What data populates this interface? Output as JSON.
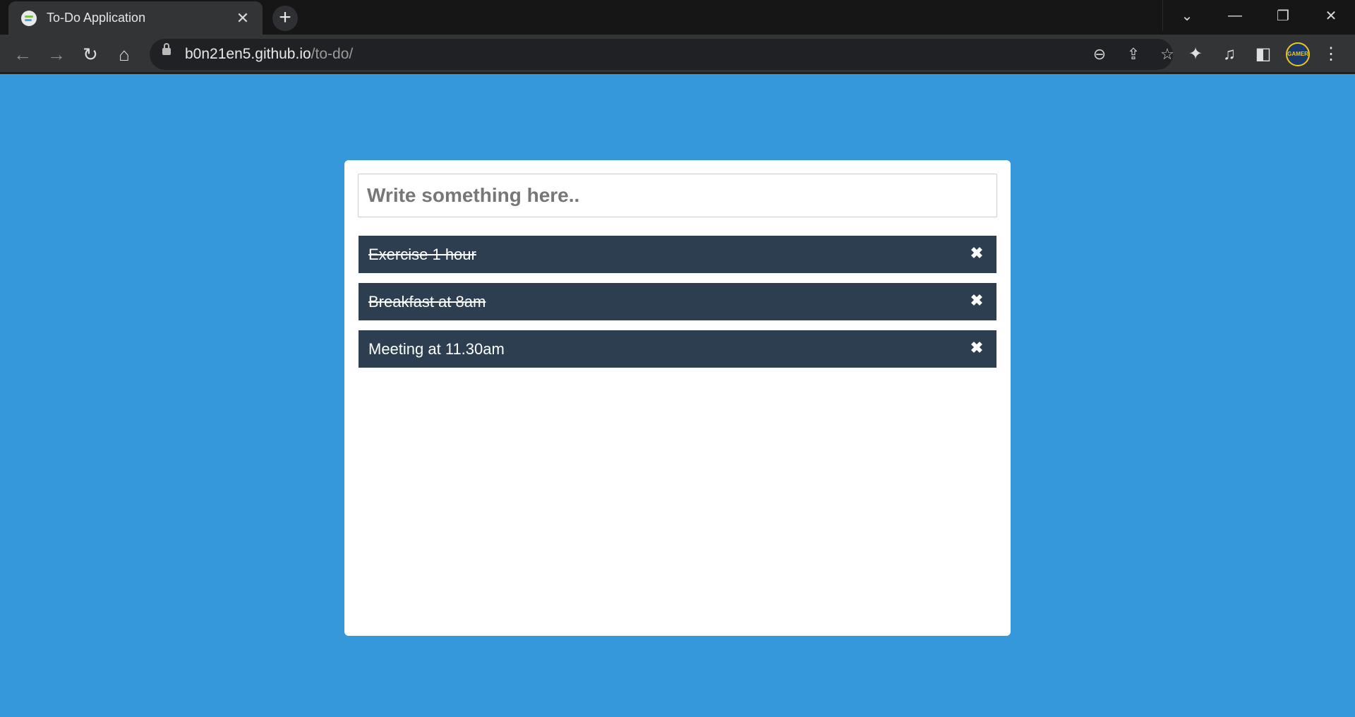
{
  "browser": {
    "tab": {
      "title": "To-Do Application",
      "favicon": "todo-favicon",
      "close_glyph": "✕"
    },
    "new_tab_glyph": "+",
    "window_controls": {
      "tab_search_glyph": "⌄",
      "minimize_glyph": "—",
      "restore_glyph": "❐",
      "close_glyph": "✕"
    },
    "nav": {
      "back_glyph": "←",
      "forward_glyph": "→",
      "reload_glyph": "↻",
      "home_glyph": "⌂"
    },
    "address": {
      "host": "b0n21en5.github.io",
      "path": "/to-do/"
    },
    "omnibox_icons": {
      "zoom_glyph": "⊖",
      "share_glyph": "⇪",
      "bookmark_glyph": "☆"
    },
    "toolbar_icons": {
      "extensions_glyph": "✦",
      "media_glyph": "♫",
      "side_panel_glyph": "◧",
      "menu_glyph": "⋮"
    },
    "profile_label": "GAMER"
  },
  "colors": {
    "page_background": "#3498db",
    "card_background": "#ffffff",
    "item_background": "#2c3e50",
    "item_text": "#ffffff"
  },
  "todo": {
    "input": {
      "placeholder": "Write something here..",
      "value": ""
    },
    "items": [
      {
        "text": "Exercise 1 hour",
        "done": true,
        "delete_glyph": "✖"
      },
      {
        "text": "Breakfast at 8am",
        "done": true,
        "delete_glyph": "✖"
      },
      {
        "text": "Meeting at 11.30am",
        "done": false,
        "delete_glyph": "✖"
      }
    ]
  }
}
